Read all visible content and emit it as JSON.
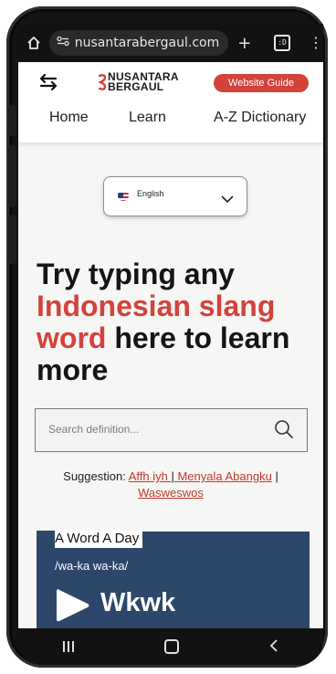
{
  "browser": {
    "url": "nusantarabergaul.com",
    "tab_count": ":D"
  },
  "header": {
    "logo_line1": "NUSANTARA",
    "logo_line2": "BERGAUL",
    "guide_button": "Website Guide",
    "nav": [
      "Home",
      "Learn",
      "A-Z Dictionary"
    ]
  },
  "language": {
    "selected": "English"
  },
  "hero": {
    "line1": "Try typing any",
    "accent": "Indonesian slang word",
    "line_end": " here to learn more"
  },
  "search": {
    "placeholder": "Search definition..."
  },
  "suggestion": {
    "label": "Suggestion: ",
    "items": [
      "Affh iyh ",
      " Menyala Abangku",
      "Wasweswos "
    ],
    "separator": "|"
  },
  "word_of_day": {
    "tag": "A Word A Day",
    "pronunciation": "/wa-ka wa-ka/",
    "word": "Wkwk"
  },
  "colors": {
    "accent": "#d3433b",
    "card": "#2c4769"
  }
}
